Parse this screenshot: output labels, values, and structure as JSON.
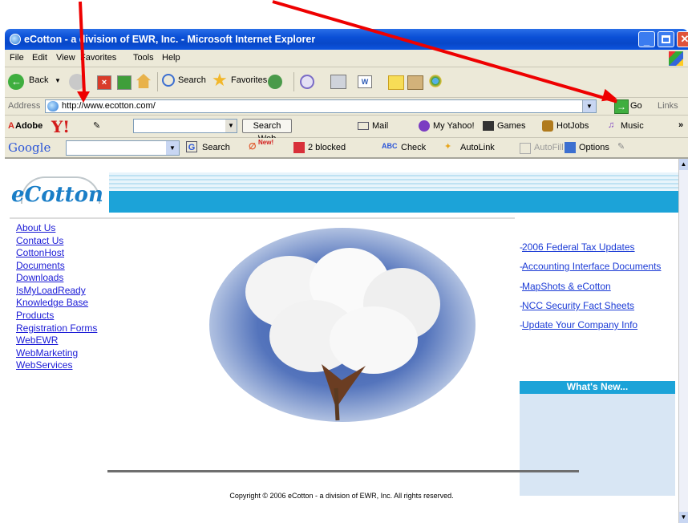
{
  "window": {
    "title": "eCotton - a division of EWR, Inc. - Microsoft Internet Explorer"
  },
  "menu": [
    "File",
    "Edit",
    "View",
    "Favorites",
    "Tools",
    "Help"
  ],
  "toolbar": {
    "back": "Back",
    "search": "Search",
    "favorites": "Favorites"
  },
  "address": {
    "label": "Address",
    "url": "http://www.ecotton.com/",
    "go": "Go",
    "links": "Links"
  },
  "yahoo_toolbar": {
    "adobe": "Adobe",
    "search_web": "Search Web",
    "mail": "Mail",
    "my_yahoo": "My Yahoo!",
    "games": "Games",
    "hotjobs": "HotJobs",
    "music": "Music"
  },
  "google_toolbar": {
    "logo": "Google",
    "search": "Search",
    "new_badge": "New!",
    "blocked": "2 blocked",
    "check": "Check",
    "autolink": "AutoLink",
    "autofill": "AutoFill",
    "options": "Options"
  },
  "site": {
    "logo": "eCotton",
    "nav": [
      "About Us",
      "Contact Us",
      "CottonHost",
      "Documents",
      "Downloads",
      "IsMyLoadReady",
      "Knowledge Base",
      "Products",
      "Registration Forms",
      "WebEWR",
      "WebMarketing",
      "WebServices"
    ],
    "whats_new": {
      "title": "What's New...",
      "items": [
        "2006 Federal Tax Updates",
        "Accounting Interface Documents",
        "MapShots & eCotton",
        "NCC Security Fact Sheets",
        "Update Your Company Info"
      ]
    },
    "copyright": "Copyright © 2006 eCotton - a division of EWR, Inc. All rights reserved."
  },
  "colors": {
    "titlebar": "#0a4fd6",
    "accent_blue": "#1ca3d8",
    "link": "#1b1bd6",
    "annotation_arrow": "#ee0000"
  },
  "icons": [
    "ie-icon",
    "back-icon",
    "forward-icon",
    "stop-icon",
    "refresh-icon",
    "home-icon",
    "search-icon",
    "favorites-star-icon",
    "history-icon",
    "mail-icon",
    "print-icon",
    "go-arrow-icon"
  ]
}
